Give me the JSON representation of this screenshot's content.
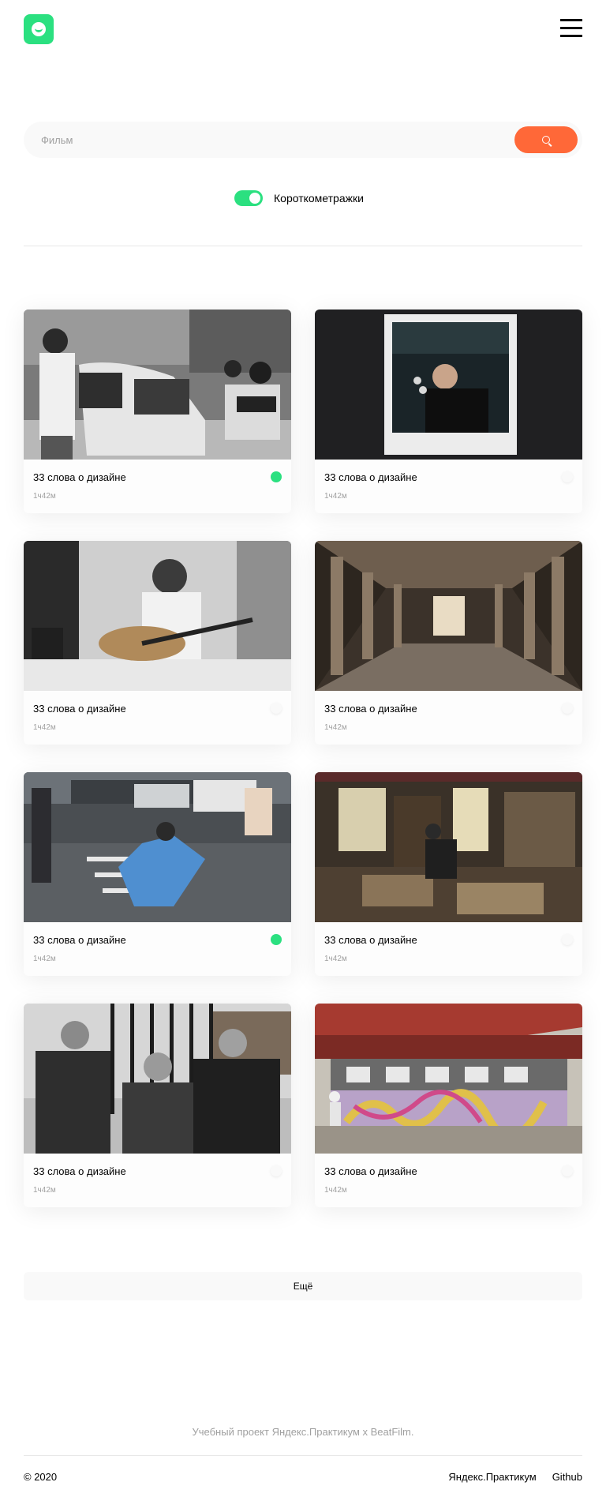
{
  "header": {
    "logo_icon": "smile-logo-icon",
    "menu_icon": "hamburger-menu-icon"
  },
  "search": {
    "placeholder": "Фильм",
    "value": "",
    "button_icon": "search-icon"
  },
  "filter": {
    "label": "Короткометражки",
    "enabled": true
  },
  "movies": [
    {
      "title": "33 слова о дизайне",
      "duration": "1ч42м",
      "saved": true
    },
    {
      "title": "33 слова о дизайне",
      "duration": "1ч42м",
      "saved": false
    },
    {
      "title": "33 слова о дизайне",
      "duration": "1ч42м",
      "saved": false
    },
    {
      "title": "33 слова о дизайне",
      "duration": "1ч42м",
      "saved": false
    },
    {
      "title": "33 слова о дизайне",
      "duration": "1ч42м",
      "saved": true
    },
    {
      "title": "33 слова о дизайне",
      "duration": "1ч42м",
      "saved": false
    },
    {
      "title": "33 слова о дизайне",
      "duration": "1ч42м",
      "saved": false
    },
    {
      "title": "33 слова о дизайне",
      "duration": "1ч42м",
      "saved": false
    }
  ],
  "more_label": "Ещё",
  "footer": {
    "note": "Учебный проект Яндекс.Практикум х BeatFilm.",
    "copyright": "© 2020",
    "links": [
      "Яндекс.Практикум",
      "Github"
    ]
  },
  "colors": {
    "accent": "#2BE080",
    "search_button": "#FF6838",
    "muted": "#A0A0A0"
  }
}
